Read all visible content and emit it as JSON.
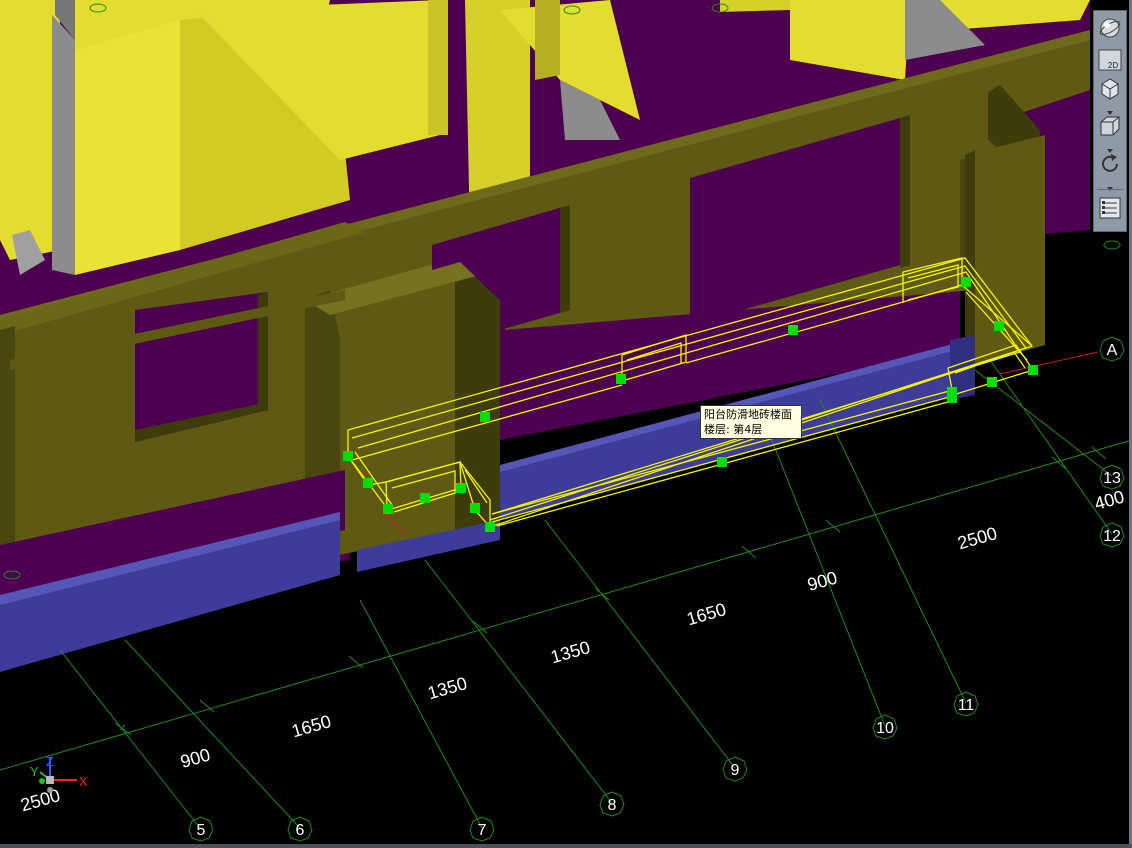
{
  "scene": {
    "label": "3D building model view",
    "grid_axis_labels": [
      "5",
      "6",
      "7",
      "8",
      "9",
      "10",
      "11",
      "12",
      "13",
      "A"
    ],
    "dimensions": [
      "2500",
      "900",
      "1650",
      "1350",
      "1350",
      "1650",
      "900",
      "2500",
      "400"
    ]
  },
  "tooltip": {
    "line1": "阳台防滑地砖楼面",
    "line2": "楼层: 第4层"
  },
  "toolbar": {
    "buttons": [
      "orbit-icon",
      "2d-view-icon",
      "iso-view-icon",
      "cube-view-icon",
      "rotate-icon",
      "properties-icon"
    ],
    "badge_2d": "2D"
  },
  "ucs": {
    "x": "X",
    "y": "Y",
    "z": "Z"
  },
  "colors": {
    "wall": "#5e5a14",
    "wall_dark": "#3f3c0c",
    "wall_light": "#8f8a22",
    "floor": "#4e0050",
    "slab": "#e2dd2e",
    "slab_side": "#c9c427",
    "column_gray": "#8c8c8c",
    "beam_blue": "#3d3d99",
    "selection": "#f5f500",
    "grip": "#00e000",
    "grid": "#1f8a1f"
  }
}
